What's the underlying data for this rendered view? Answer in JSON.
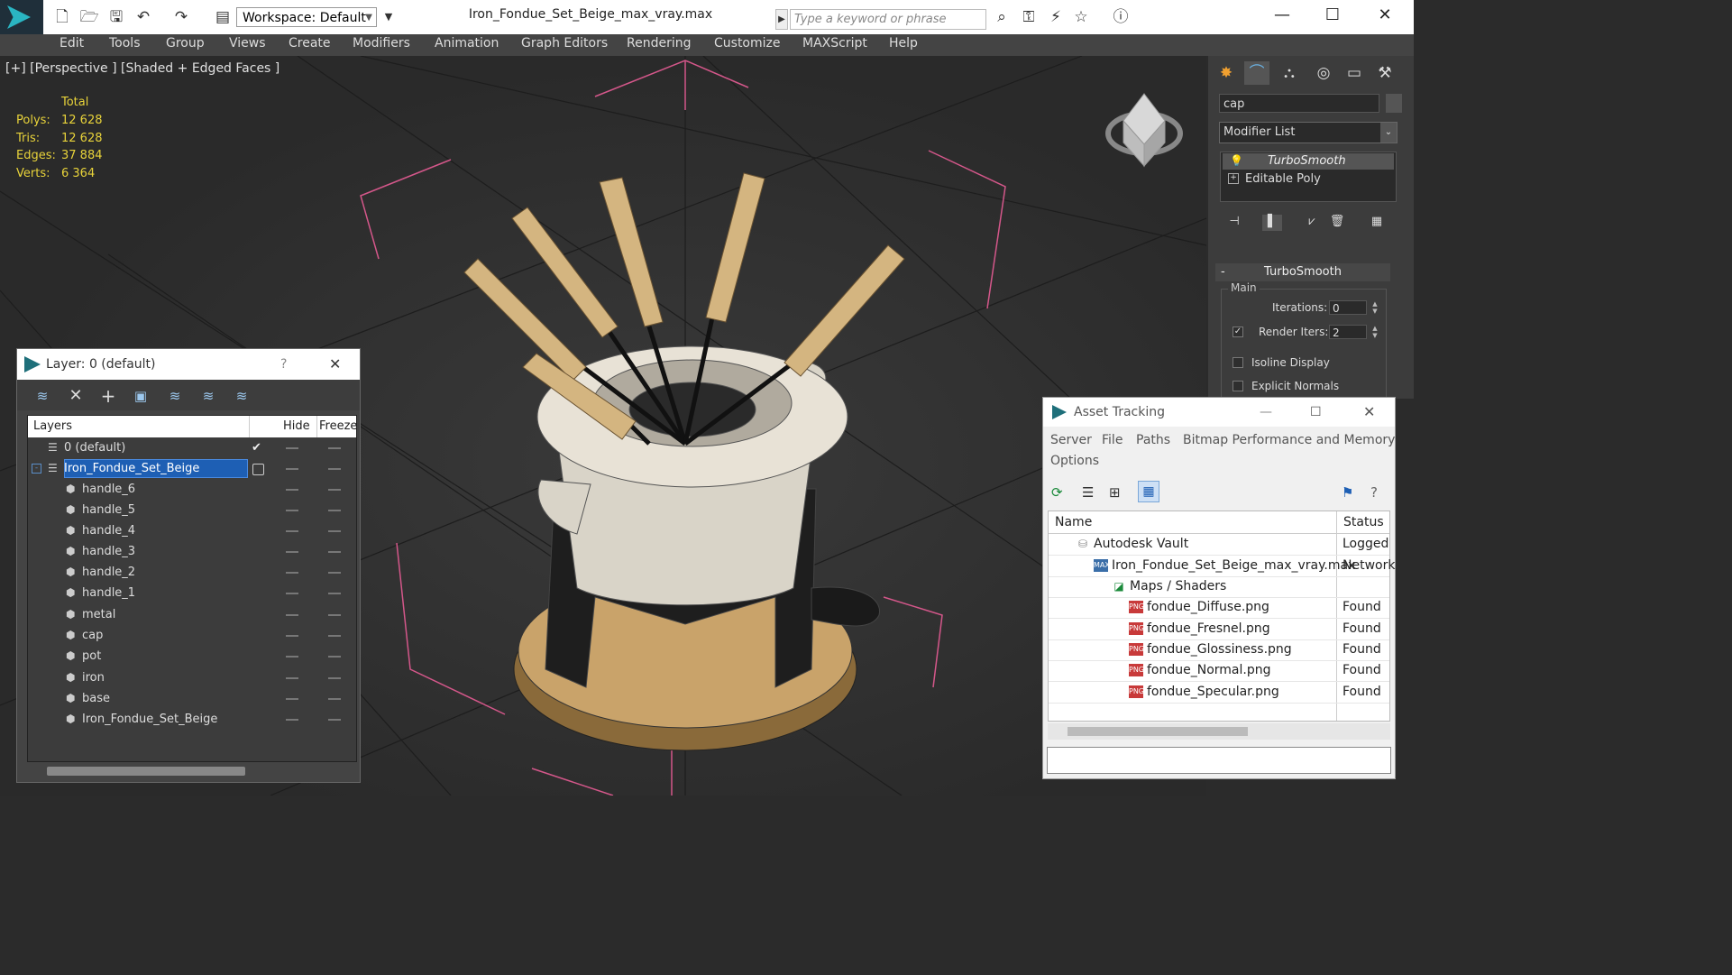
{
  "titlebar": {
    "workspace_label": "Workspace: Default",
    "document_title": "Iron_Fondue_Set_Beige_max_vray.max",
    "search_placeholder": "Type a keyword or phrase"
  },
  "menu": [
    "Edit",
    "Tools",
    "Group",
    "Views",
    "Create",
    "Modifiers",
    "Animation",
    "Graph Editors",
    "Rendering",
    "Customize",
    "MAXScript",
    "Help"
  ],
  "viewport": {
    "label": "[+] [Perspective ] [Shaded + Edged Faces ]",
    "stats": {
      "header": "Total",
      "rows": [
        {
          "label": "Polys:",
          "value": "12 628"
        },
        {
          "label": "Tris:",
          "value": "12 628"
        },
        {
          "label": "Edges:",
          "value": "37 884"
        },
        {
          "label": "Verts:",
          "value": "6 364"
        }
      ]
    }
  },
  "command_panel": {
    "object_name": "cap",
    "modifier_list": "Modifier List",
    "stack": [
      "TurboSmooth",
      "Editable Poly"
    ],
    "rollout_title": "TurboSmooth",
    "group_label": "Main",
    "iterations_label": "Iterations:",
    "iterations_value": "0",
    "render_iters_label": "Render Iters:",
    "render_iters_value": "2",
    "render_iters_checked": true,
    "isoline_label": "Isoline Display",
    "explicit_normals_label": "Explicit Normals"
  },
  "layer_window": {
    "title": "Layer: 0 (default)",
    "help": "?",
    "columns": {
      "layers": "Layers",
      "hide": "Hide",
      "freeze": "Freeze"
    },
    "rows": [
      {
        "name": "0 (default)",
        "level": 0
      },
      {
        "name": "Iron_Fondue_Set_Beige",
        "level": 0,
        "selected": true
      },
      {
        "name": "handle_6",
        "level": 1
      },
      {
        "name": "handle_5",
        "level": 1
      },
      {
        "name": "handle_4",
        "level": 1
      },
      {
        "name": "handle_3",
        "level": 1
      },
      {
        "name": "handle_2",
        "level": 1
      },
      {
        "name": "handle_1",
        "level": 1
      },
      {
        "name": "metal",
        "level": 1
      },
      {
        "name": "cap",
        "level": 1
      },
      {
        "name": "pot",
        "level": 1
      },
      {
        "name": "iron",
        "level": 1
      },
      {
        "name": "base",
        "level": 1
      },
      {
        "name": "Iron_Fondue_Set_Beige",
        "level": 1
      }
    ]
  },
  "asset_window": {
    "title": "Asset Tracking",
    "menu": [
      "Server",
      "File",
      "Paths",
      "Bitmap Performance and Memory",
      "Options"
    ],
    "columns": {
      "name": "Name",
      "status": "Status"
    },
    "rows": [
      {
        "name": "Autodesk Vault",
        "status": "Logged",
        "indent": 0,
        "icon": "vault"
      },
      {
        "name": "Iron_Fondue_Set_Beige_max_vray.max",
        "status": "Network",
        "indent": 1,
        "icon": "max"
      },
      {
        "name": "Maps / Shaders",
        "status": "",
        "indent": 2,
        "icon": "maps"
      },
      {
        "name": "fondue_Diffuse.png",
        "status": "Found",
        "indent": 3,
        "icon": "png"
      },
      {
        "name": "fondue_Fresnel.png",
        "status": "Found",
        "indent": 3,
        "icon": "png"
      },
      {
        "name": "fondue_Glossiness.png",
        "status": "Found",
        "indent": 3,
        "icon": "png"
      },
      {
        "name": "fondue_Normal.png",
        "status": "Found",
        "indent": 3,
        "icon": "png"
      },
      {
        "name": "fondue_Specular.png",
        "status": "Found",
        "indent": 3,
        "icon": "png"
      }
    ]
  },
  "colors": {
    "accent": "#2ab5c2",
    "stats_yellow": "#e8d33a",
    "selection_blue": "#1e5fb4",
    "bbox_pink": "#d4578a",
    "wood": "#c9a36a",
    "ceramic": "#e8e2d6"
  }
}
